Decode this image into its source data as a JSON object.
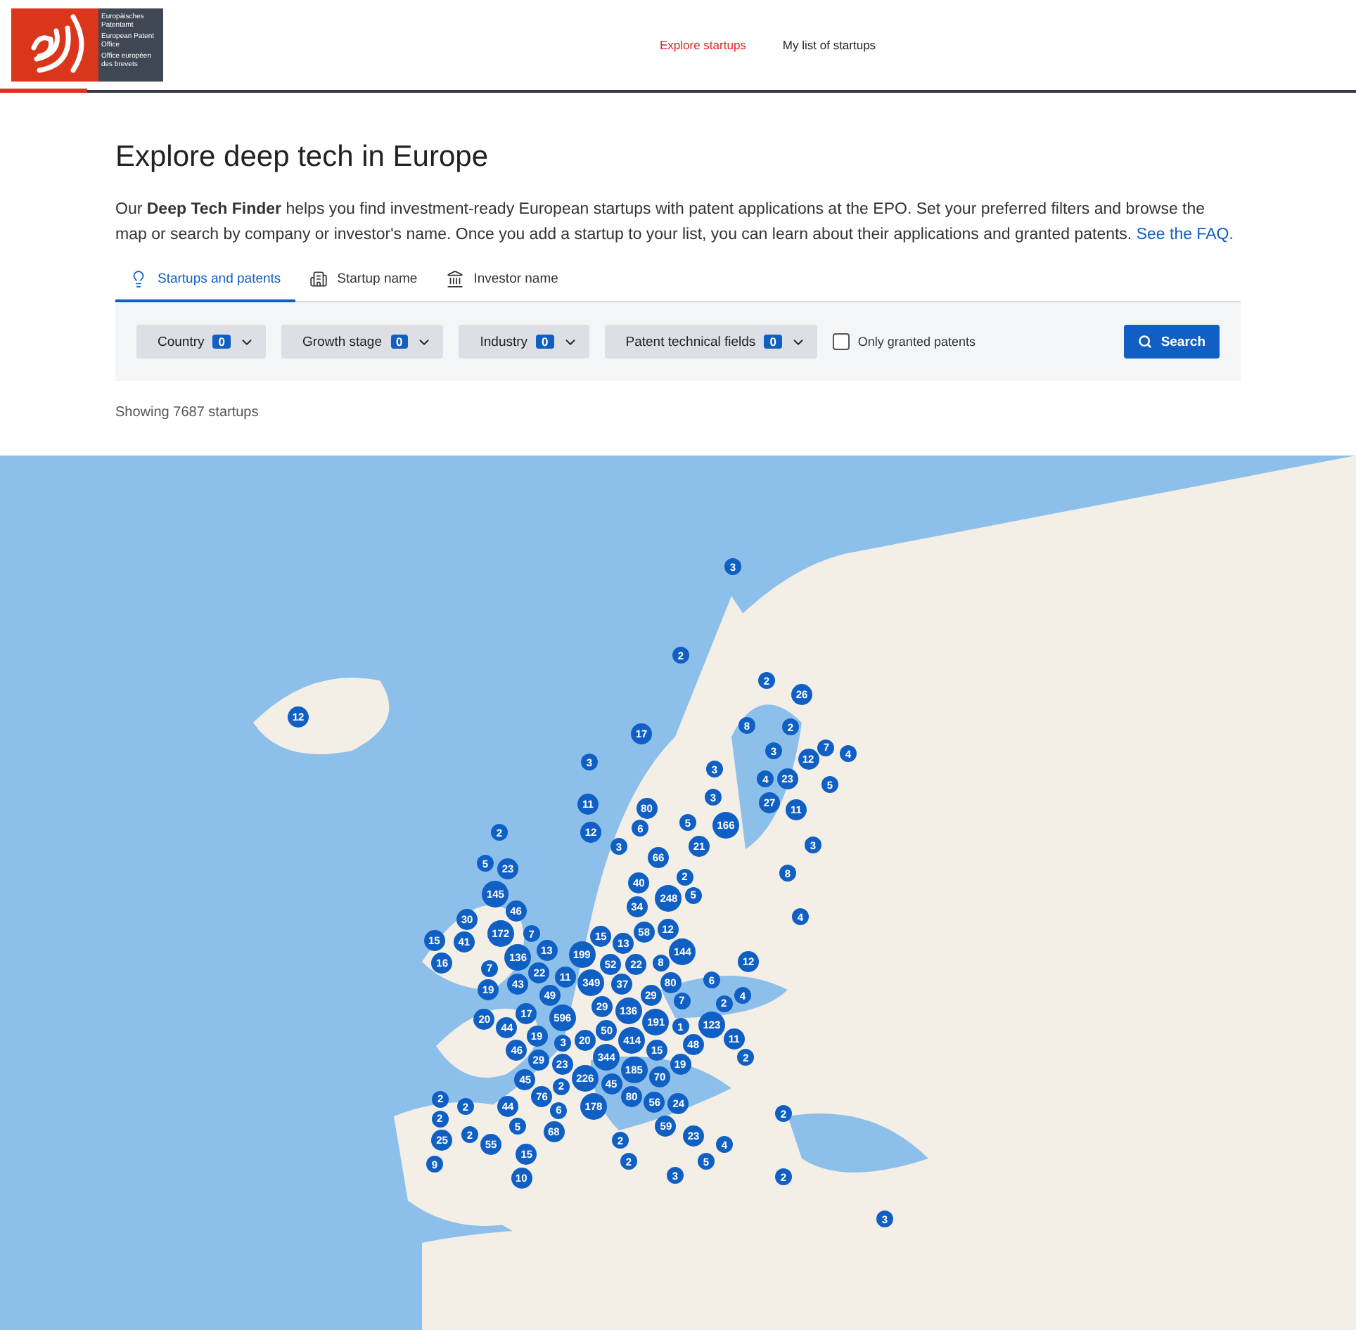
{
  "header": {
    "logo_lines": [
      "Europäisches Patentamt",
      "European Patent Office",
      "Office européen des brevets"
    ],
    "nav": [
      {
        "label": "Explore startups",
        "selected": true
      },
      {
        "label": "My list of startups",
        "selected": false
      }
    ]
  },
  "title": "Explore deep tech in Europe",
  "intro": {
    "text": "Our **Deep Tech Finder** helps you find investment-ready European startups with patent applications at the EPO. Set your preferred filters and browse the map or search by company or investor's name. Once you add a startup to your list, you can learn about their applications and granted patents.",
    "link": "See the FAQ."
  },
  "tabs": [
    {
      "label": "Startups and patents",
      "selected": true
    },
    {
      "label": "Startup name",
      "selected": false
    },
    {
      "label": "Investor name",
      "selected": false
    }
  ],
  "filters": [
    {
      "label": "Country",
      "count": "0"
    },
    {
      "label": "Growth stage",
      "count": "0"
    },
    {
      "label": "Industry",
      "count": "0"
    },
    {
      "label": "Patent technical fields",
      "count": "0"
    }
  ],
  "only_granted": {
    "label": "Only granted patents",
    "checked": false
  },
  "search_button": "Search",
  "result_count": "Showing 7687 startups",
  "map": {
    "markers": [
      "3",
      "2",
      "2",
      "26",
      "12",
      "17",
      "8",
      "2",
      "3",
      "3",
      "3",
      "12",
      "7",
      "4",
      "4",
      "23",
      "5",
      "11",
      "80",
      "3",
      "27",
      "11",
      "2",
      "12",
      "6",
      "5",
      "166",
      "3",
      "21",
      "3",
      "5",
      "23",
      "66",
      "2",
      "8",
      "145",
      "40",
      "34",
      "248",
      "5",
      "30",
      "46",
      "12",
      "4",
      "15",
      "41",
      "172",
      "7",
      "15",
      "13",
      "58",
      "16",
      "7",
      "136",
      "22",
      "13",
      "199",
      "52",
      "22",
      "8",
      "144",
      "12",
      "19",
      "43",
      "49",
      "11",
      "349",
      "80",
      "6",
      "29",
      "37",
      "29",
      "7",
      "2",
      "4",
      "20",
      "44",
      "17",
      "596",
      "50",
      "136",
      "191",
      "1",
      "123",
      "46",
      "19",
      "3",
      "20",
      "414",
      "15",
      "48",
      "11",
      "29",
      "23",
      "344",
      "185",
      "70",
      "19",
      "2",
      "45",
      "2",
      "226",
      "45",
      "2",
      "2",
      "44",
      "76",
      "6",
      "178",
      "80",
      "56",
      "24",
      "2",
      "2",
      "25",
      "2",
      "5",
      "68",
      "59",
      "23",
      "55",
      "2",
      "4",
      "9",
      "10",
      "15",
      "2",
      "3",
      "5",
      "2",
      "3"
    ]
  }
}
